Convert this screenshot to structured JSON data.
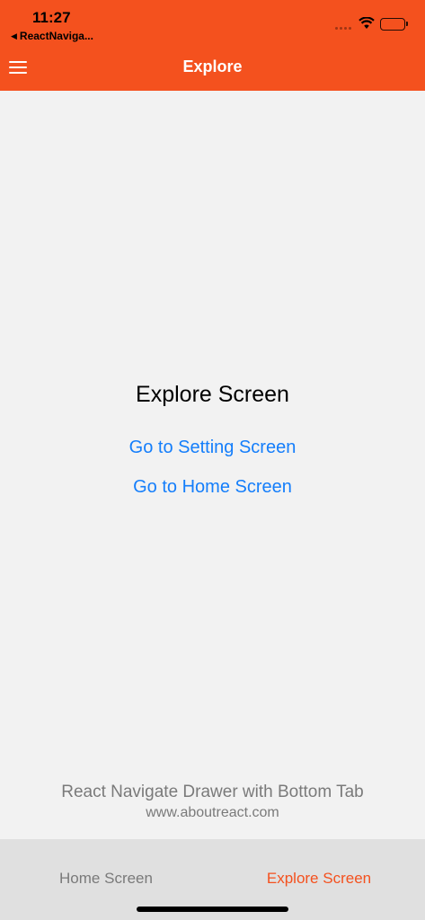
{
  "status_bar": {
    "time": "11:27",
    "back_app": "ReactNaviga..."
  },
  "header": {
    "title": "Explore",
    "background": "#f4511e"
  },
  "main": {
    "title": "Explore Screen",
    "link_setting": "Go to Setting Screen",
    "link_home": "Go to Home Screen"
  },
  "footer": {
    "title": "React Navigate Drawer with Bottom Tab",
    "url": "www.aboutreact.com"
  },
  "tabs": [
    {
      "label": "Home Screen",
      "active": false
    },
    {
      "label": "Explore Screen",
      "active": true
    }
  ],
  "colors": {
    "accent": "#f4511e",
    "link": "#147efb"
  }
}
